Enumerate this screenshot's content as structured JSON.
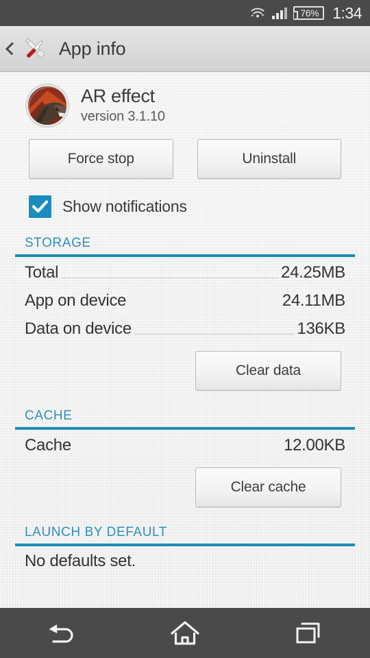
{
  "statusbar": {
    "wifi_icon": "wifi-icon",
    "signal_icon": "signal-bars-icon",
    "signal_bars_total": 4,
    "signal_bars_filled": 3,
    "battery_icon": "battery-icon",
    "battery_level": "76%",
    "clock": "1:34"
  },
  "actionbar": {
    "back_icon": "back-chevron-icon",
    "app_icon": "settings-tools-icon",
    "title": "App info"
  },
  "app": {
    "icon": "ar-effect-dinosaur-icon",
    "name": "AR effect",
    "version": "version 3.1.10"
  },
  "buttons": {
    "force_stop": "Force stop",
    "uninstall": "Uninstall",
    "clear_data": "Clear data",
    "clear_cache": "Clear cache"
  },
  "notifications": {
    "label": "Show notifications",
    "checked": true,
    "check_icon": "checkmark-icon"
  },
  "sections": [
    {
      "title": "STORAGE",
      "rows": [
        {
          "label": "Total",
          "value": "24.25MB",
          "leader": true
        },
        {
          "label": "App on device",
          "value": "24.11MB",
          "leader": false
        },
        {
          "label": "Data on device",
          "value": "136KB",
          "leader": true
        }
      ]
    },
    {
      "title": "CACHE",
      "rows": [
        {
          "label": "Cache",
          "value": "12.00KB",
          "leader": false
        }
      ]
    },
    {
      "title": "LAUNCH BY DEFAULT",
      "rows": [
        {
          "label": "No defaults set.",
          "value": "",
          "leader": false
        }
      ]
    }
  ],
  "launch_default": {
    "text": "No defaults set."
  },
  "navbar": {
    "back": "back-nav-icon",
    "home": "home-nav-icon",
    "recents": "recents-nav-icon"
  },
  "colors": {
    "accent_blue": "#1d8cb4",
    "section_title_blue": "#2f8fb8",
    "checkbox_blue": "#1a8cbe",
    "statusbar_bg": "#4a4a4a",
    "actionbar_bg": "#dcdcdc",
    "content_bg": "#eeeeee",
    "text_primary": "#333333"
  }
}
